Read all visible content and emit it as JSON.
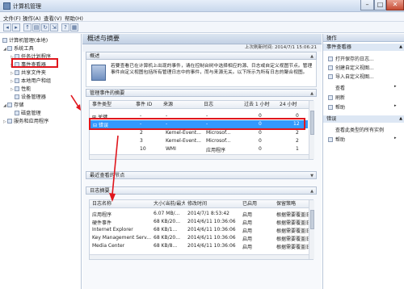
{
  "window": {
    "title": "计算机管理"
  },
  "menu": [
    "文件(F)",
    "操作(A)",
    "查看(V)",
    "帮助(H)"
  ],
  "toolbar_icons": [
    "back-icon",
    "forward-icon",
    "up-icon",
    "console-tree-icon",
    "refresh-icon",
    "export-icon",
    "help-icon",
    "properties-icon"
  ],
  "tree": [
    {
      "label": "计算机管理(本地)",
      "level": 0
    },
    {
      "label": "系统工具",
      "level": 1
    },
    {
      "label": "任务计划程序",
      "level": 2
    },
    {
      "label": "事件查看器",
      "level": 2
    },
    {
      "label": "共享文件夹",
      "level": 2
    },
    {
      "label": "本地用户和组",
      "level": 2
    },
    {
      "label": "性能",
      "level": 2
    },
    {
      "label": "设备管理器",
      "level": 2
    },
    {
      "label": "存储",
      "level": 1
    },
    {
      "label": "磁盘管理",
      "level": 2
    },
    {
      "label": "服务和应用程序",
      "level": 1
    }
  ],
  "center": {
    "title": "概述与摘要",
    "refresh_text": "上次刷新时间: 2014/7/1 15:06:21",
    "overview_header": "概述",
    "overview_text": "若要查看已在计算机上出现的事件，请在控制台树中选择相应的源、日志或自定义视图节点。管理事件自定义视图包括所有管理日志中的事件，而与来源无关。以下所示为所有日志的聚合视图。",
    "summary_header": "管理事件的摘要",
    "summary_columns": [
      "事件类型",
      "事件 ID",
      "来源",
      "日志",
      "过去 1 小时",
      "24 小时"
    ],
    "summary_rows": [
      {
        "type": "关键",
        "id": "-",
        "source": "-",
        "log": "-",
        "h1": "0",
        "h24": "0"
      },
      {
        "type": "错误",
        "id": "-",
        "source": "-",
        "log": "-",
        "h1": "0",
        "h24": "12"
      },
      {
        "type": "",
        "id": "2",
        "source": "Kernel-Event...",
        "log": "Microsof...",
        "h1": "0",
        "h24": "2"
      },
      {
        "type": "",
        "id": "3",
        "source": "Kernel-Event...",
        "log": "Microsof...",
        "h1": "0",
        "h24": "2"
      },
      {
        "type": "",
        "id": "10",
        "source": "WMI",
        "log": "应用程序",
        "h1": "0",
        "h24": "1"
      }
    ],
    "recent_header": "最近查看的节点",
    "logs_header": "日志摘要",
    "logs_columns": [
      "日志名称",
      "大小(当前/最大)",
      "修改时间",
      "已启用",
      "保留策略"
    ],
    "logs_rows": [
      {
        "name": "应用程序",
        "size": "6.07 MB/...",
        "modified": "2014/7/1 8:53:42",
        "enabled": "启用",
        "policy": "根据需要覆盖旧..."
      },
      {
        "name": "硬件事件",
        "size": "68 KB/20...",
        "modified": "2014/6/11 10:36:06",
        "enabled": "启用",
        "policy": "根据需要覆盖旧..."
      },
      {
        "name": "Internet Explorer",
        "size": "68 KB/1...",
        "modified": "2014/6/11 10:36:06",
        "enabled": "启用",
        "policy": "根据需要覆盖旧..."
      },
      {
        "name": "Key Management Serv...",
        "size": "68 KB/20...",
        "modified": "2014/6/11 10:36:06",
        "enabled": "启用",
        "policy": "根据需要覆盖旧..."
      },
      {
        "name": "Media Center",
        "size": "68 KB/8...",
        "modified": "2014/6/11 10:36:06",
        "enabled": "启用",
        "policy": "根据需要覆盖旧..."
      }
    ]
  },
  "actions": {
    "header": "操作",
    "section1": "事件查看器",
    "items1": [
      {
        "label": "打开保存的日志...",
        "icon": "folder-icon"
      },
      {
        "label": "创建自定义视图...",
        "icon": "filter-icon"
      },
      {
        "label": "导入自定义视图...",
        "icon": "import-icon"
      },
      {
        "label": "查看",
        "icon": "",
        "arrow": "▸"
      },
      {
        "label": "刷新",
        "icon": "refresh-icon"
      },
      {
        "label": "帮助",
        "icon": "help-icon",
        "arrow": "▸"
      }
    ],
    "section2": "错误",
    "items2": [
      {
        "label": "查看此类型的所有实例",
        "icon": ""
      },
      {
        "label": "帮助",
        "icon": "help-icon",
        "arrow": "▸"
      }
    ]
  },
  "colors": {
    "highlight": "#3399ff",
    "annotation": "#e0161d",
    "header_bg": "#c3d1e4"
  }
}
